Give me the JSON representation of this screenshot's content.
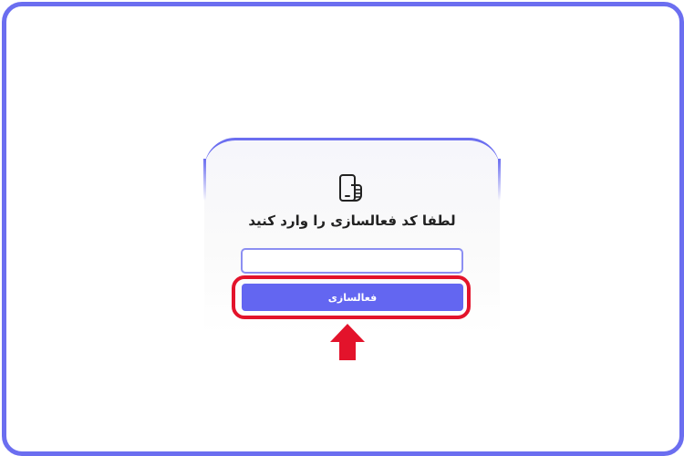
{
  "activation": {
    "icon": "hand-holding-phone-icon",
    "title": "لطفا کد فعالسازی را وارد کنید",
    "code_value": "",
    "code_placeholder": "",
    "submit_label": "فعالسازی"
  },
  "annotation": {
    "highlight_color": "#e3132b",
    "arrow_icon": "up-arrow-icon"
  },
  "colors": {
    "accent": "#6366f1",
    "frame": "#6b6ef0"
  }
}
